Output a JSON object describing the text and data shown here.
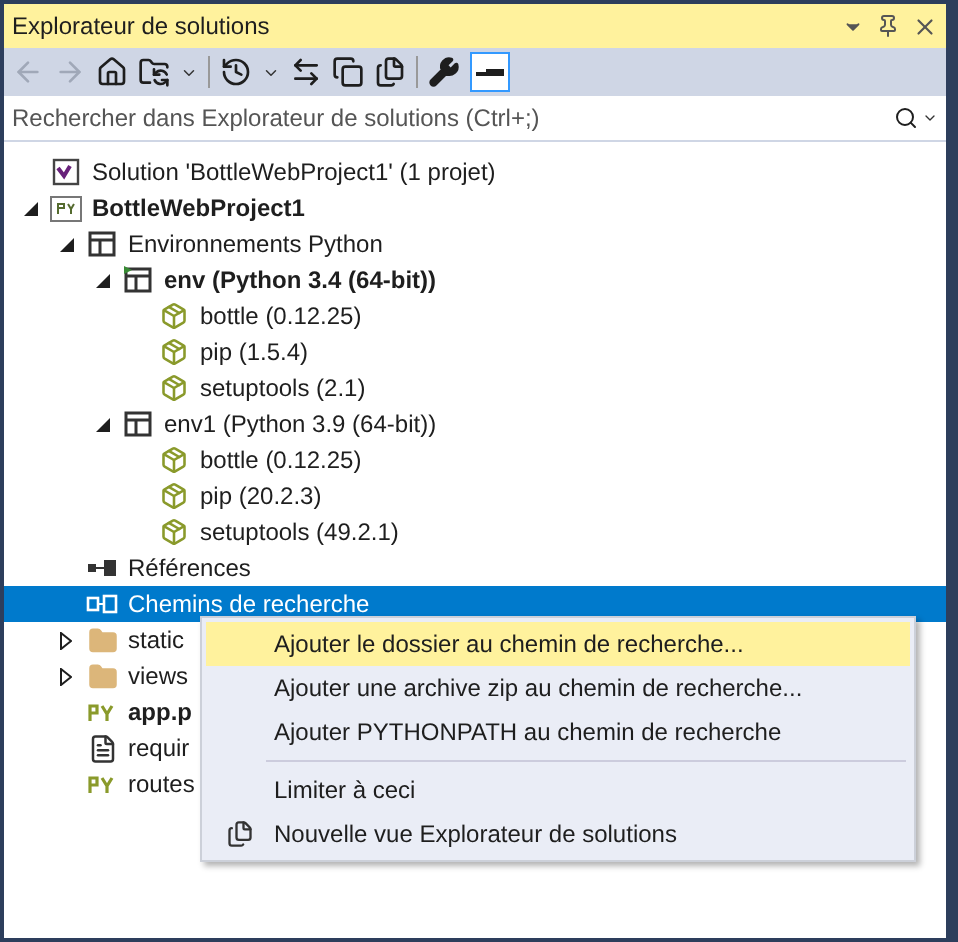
{
  "window": {
    "title": "Explorateur de solutions"
  },
  "search": {
    "placeholder": "Rechercher dans Explorateur de solutions (Ctrl+;)"
  },
  "tree": [
    {
      "kind": "solution",
      "label": "Solution 'BottleWebProject1' (1 projet)",
      "bold": false,
      "selected": false
    },
    {
      "kind": "project",
      "label": "BottleWebProject1",
      "bold": true,
      "selected": false,
      "expanded": true,
      "children": [
        {
          "kind": "envs",
          "label": "Environnements Python",
          "bold": false,
          "selected": false,
          "expanded": true,
          "children": [
            {
              "kind": "env_active",
              "label": "env (Python 3.4 (64-bit))",
              "bold": true,
              "selected": false,
              "expanded": true,
              "children": [
                {
                  "kind": "package",
                  "label": "bottle (0.12.25)",
                  "bold": false,
                  "selected": false
                },
                {
                  "kind": "package",
                  "label": "pip (1.5.4)",
                  "bold": false,
                  "selected": false
                },
                {
                  "kind": "package",
                  "label": "setuptools (2.1)",
                  "bold": false,
                  "selected": false
                }
              ]
            },
            {
              "kind": "env",
              "label": "env1 (Python 3.9 (64-bit))",
              "bold": false,
              "selected": false,
              "expanded": true,
              "children": [
                {
                  "kind": "package",
                  "label": "bottle (0.12.25)",
                  "bold": false,
                  "selected": false
                },
                {
                  "kind": "package",
                  "label": "pip (20.2.3)",
                  "bold": false,
                  "selected": false
                },
                {
                  "kind": "package",
                  "label": "setuptools (49.2.1)",
                  "bold": false,
                  "selected": false
                }
              ]
            }
          ]
        },
        {
          "kind": "references",
          "label": "Références",
          "bold": false,
          "selected": false
        },
        {
          "kind": "searchpath",
          "label": "Chemins de recherche",
          "bold": false,
          "selected": true
        },
        {
          "kind": "folder",
          "label": "static",
          "bold": false,
          "selected": false,
          "expanded": false
        },
        {
          "kind": "folder",
          "label": "views",
          "bold": false,
          "selected": false,
          "expanded": false
        },
        {
          "kind": "py",
          "label": "app.p",
          "bold": true,
          "selected": false
        },
        {
          "kind": "file",
          "label": "requir",
          "bold": false,
          "selected": false
        },
        {
          "kind": "py",
          "label": "routes",
          "bold": false,
          "selected": false
        }
      ]
    }
  ],
  "context_menu": [
    {
      "kind": "item",
      "label": "Ajouter le dossier au chemin de recherche...",
      "selected": true
    },
    {
      "kind": "item",
      "label": "Ajouter une archive zip au chemin de recherche...",
      "selected": false
    },
    {
      "kind": "item",
      "label": "Ajouter PYTHONPATH au chemin de recherche",
      "selected": false
    },
    {
      "kind": "separator"
    },
    {
      "kind": "item",
      "label": "Limiter à ceci",
      "selected": false
    },
    {
      "kind": "new_view",
      "label": "Nouvelle vue Explorateur de solutions",
      "selected": false
    }
  ]
}
